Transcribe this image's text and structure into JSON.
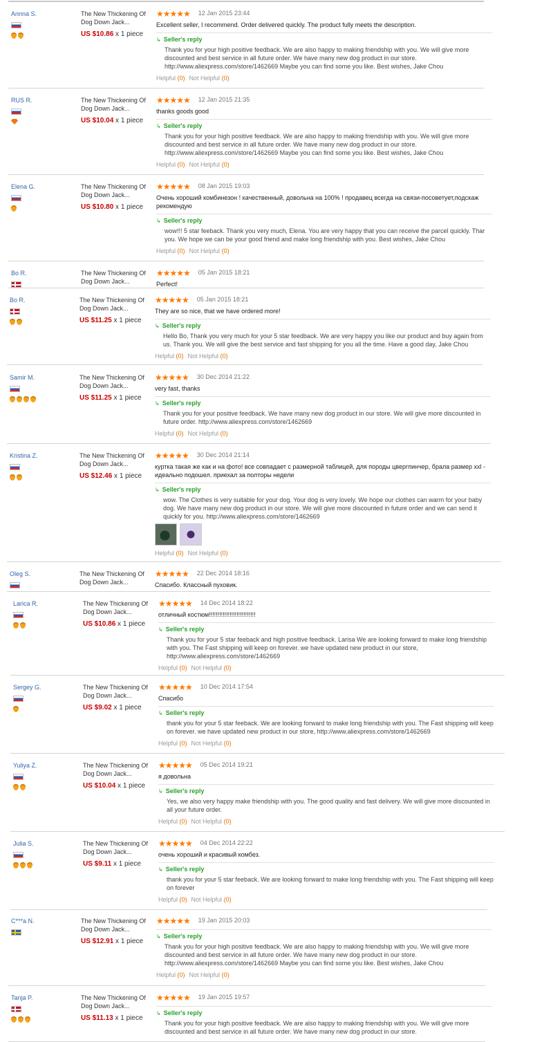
{
  "page": {
    "helpful_label": "Helpful",
    "not_helpful_label": "Not Helpful",
    "reply_label": "Seller's reply"
  },
  "reviews": [
    {
      "buyer": "Annna S.",
      "flag": "ru",
      "medals": 2,
      "product": "The New Thickening Of Dog Down Jack...",
      "price": "US $10.86",
      "qty": "x 1 piece",
      "stars": "★★★★★",
      "date": "12 Jan 2015 23:44",
      "feedback": "Excellent seller, I recommend. Order delivered quickly. The product fully meets the description.",
      "reply": "Thank you for your high positive feedback. We are also happy to making friendship with you. We will give more discounted and best service in all future order. We have many new dog product in our store. http://www.aliexpress.com/store/1462669 Maybe you can find some you like. Best wishes, Jake Chou",
      "helpful": "(0)",
      "not_helpful": "(0)"
    },
    {
      "buyer": "RUS R.",
      "flag": "ru",
      "medals": 0,
      "product": "The New Thickening Of Dog Down Jack...",
      "price": "US $10.04",
      "qty": "x 1 piece",
      "stars": "★★★★★",
      "date": "12 Jan 2015 21:35",
      "feedback": "thanks goods good",
      "reply": "Thank you for your high positive feedback. We are also happy to making friendship with you. We will give more discounted and best service in all future order. We have many new dog product in our store. http://www.aliexpress.com/store/1462669 Maybe you can find some you like. Best wishes, Jake Chou",
      "helpful": "(0)",
      "not_helpful": "(0)"
    },
    {
      "buyer": "Elena G.",
      "flag": "ru",
      "medals": 1,
      "product": "The New Thickening Of Dog Down Jack...",
      "price": "US $10.80",
      "qty": "x 1 piece",
      "stars": "★★★★★",
      "date": "08 Jan 2015 19:03",
      "feedback": "Очень хороший комбинезон ! качественный, довольна на 100% ! продавец всегда на связи-посоветует,подскаж рекомендую",
      "reply": "wow!!! 5 star feeback. Thank you very much, Elena. You are very happy that you can receive the parcel quickly. Thar you. We hope we can be your good friend and make long friendship with you. Best wishes, Jake Chou",
      "helpful": "(0)",
      "not_helpful": "(0)"
    },
    {
      "buyer": "Bo R.",
      "flag": "dk",
      "medals": 0,
      "product": "The New Thickening Of Dog Down Jack...",
      "price": "",
      "qty": "",
      "stars": "★★★★★",
      "date": "05 Jan 2015 18:21",
      "feedback": "Perfect!",
      "reply": "",
      "helpful": "",
      "not_helpful": ""
    },
    {
      "buyer": "Bo R.",
      "flag": "dk",
      "medals": 2,
      "product": "The New Thickening Of Dog Down Jack...",
      "price": "US $11.25",
      "qty": "x 1 piece",
      "stars": "★★★★★",
      "date": "05 Jan 2015 18:21",
      "feedback": "They are so nice, that we have ordered more!",
      "reply": "Hello Bo, Thank you very much for your 5 star feedback. We are very happy you like our product and buy again from us. Thank you. We will give the best service and fast shipping for you all the time. Have a good day, Jake Chou",
      "helpful": "(0)",
      "not_helpful": "(0)"
    },
    {
      "buyer": "Samir M.",
      "flag": "ru",
      "medals": 4,
      "product": "The New Thickening Of Dog Down Jack...",
      "price": "US $11.25",
      "qty": "x 1 piece",
      "stars": "★★★★★",
      "date": "30 Dec 2014 21:22",
      "feedback": "very fast, thanks",
      "reply": "Thank you for your positive feedback. We have many new dog product in our store. We will give more discounted in future order. http://www.aliexpress.com/store/1462669",
      "helpful": "(0)",
      "not_helpful": "(0)"
    },
    {
      "buyer": "Kristina Z.",
      "flag": "ru",
      "medals": 2,
      "product": "The New Thickening Of Dog Down Jack...",
      "price": "US $12.46",
      "qty": "x 1 piece",
      "stars": "★★★★★",
      "date": "30 Dec 2014 21:14",
      "feedback": "куртка такая же как и на фото! все совпадает с размерной таблицей, для породы цвергпинчер, брала размер xxl - идеально подошел. приехал за полторы недели",
      "reply": "wow. The Clothes is very suitable for your dog. Your dog is very lovely. We hope our clothes can warm for your baby dog. We have many new dog product in our store. We will give more discounted in future order and we can send it quickly for you. http://www.aliexpress.com/store/1462669",
      "helpful": "(0)",
      "not_helpful": "(0)"
    },
    {
      "buyer": "Oleg S.",
      "flag": "ru",
      "medals": 0,
      "product": "The New Thickening Of Dog Down Jack...",
      "price": "",
      "qty": "",
      "stars": "★★★★★",
      "date": "22 Dec 2014 18:16",
      "feedback": "Спасибо. Классный пуховик.",
      "reply": "",
      "helpful": "",
      "not_helpful": ""
    },
    {
      "buyer": "Larica R.",
      "flag": "ru",
      "medals": 2,
      "product": "The New Thickening Of Dog Down Jack...",
      "price": "US $10.86",
      "qty": "x 1 piece",
      "stars": "★★★★★",
      "date": "14 Dec 2014 18:22",
      "feedback": "отличный костюм!!!!!!!!!!!!!!!!!!!!!!!!!!!",
      "reply": "Thank you for your 5 star feeback and high positive feedback. Larisa We are looking forward to make long friendship with you. The Fast shipping will keep on forever. we have updated new product in our store, http://www.aliexpress.com/store/1462669",
      "helpful": "(0)",
      "not_helpful": "(0)"
    },
    {
      "buyer": "Sergey G.",
      "flag": "ru",
      "medals": 1,
      "product": "The New Thickening Of Dog Down Jack...",
      "price": "US $9.02",
      "qty": "x 1 piece",
      "stars": "★★★★★",
      "date": "10 Dec 2014 17:54",
      "feedback": "Спасибо",
      "reply": "thank you for your 5 star feeback. We are looking forward to make long friendship with you. The Fast shipping will keep on forever. we have updated new product in our store, http://www.aliexpress.com/store/1462669",
      "helpful": "(0)",
      "not_helpful": "(0)"
    },
    {
      "buyer": "Yuliya Z.",
      "flag": "ru",
      "medals": 2,
      "product": "The New Thickening Of Dog Down Jack...",
      "price": "US $10.04",
      "qty": "x 1 piece",
      "stars": "★★★★★",
      "date": "05 Dec 2014 19:21",
      "feedback": "я довольна",
      "reply": "Yes, we also very happy make friendship with you. The good quality and fast delivery. We will give more discounted in all your future order.",
      "helpful": "(0)",
      "not_helpful": "(0)"
    },
    {
      "buyer": "Julia S.",
      "flag": "ru",
      "medals": 3,
      "product": "The New Thickening Of Dog Down Jack...",
      "price": "US $9.11",
      "qty": "x 1 piece",
      "stars": "★★★★★",
      "date": "04 Dec 2014 22:22",
      "feedback": "очень хороший и красивый комбез.",
      "reply": "thank you for your 5 star feeback. We are looking forward to make long friendship with you. The Fast shipping will keep on forever",
      "helpful": "(0)",
      "not_helpful": "(0)"
    },
    {
      "buyer": "C***a N.",
      "flag": "se",
      "medals": 0,
      "product": "The New Thickening Of Dog Down Jack...",
      "price": "US $12.91",
      "qty": "x 1 piece",
      "stars": "★★★★★",
      "date": "19 Jan 2015 20:03",
      "feedback": "",
      "reply": "Thank you for your high positive feedback. We are also happy to making friendship with you. We will give more discounted and best service in all future order. We have many new dog product in our store. http://www.aliexpress.com/store/1462669 Maybe you can find some you like. Best wishes, Jake Chou",
      "helpful": "(0)",
      "not_helpful": "(0)"
    },
    {
      "buyer": "Tanja P.",
      "flag": "dk",
      "medals": 3,
      "product": "The New Thickening Of Dog Down Jack...",
      "price": "US $11.13",
      "qty": "x 1 piece",
      "stars": "★★★★★",
      "date": "19 Jan 2015 19:57",
      "feedback": "",
      "reply": "Thank you for your high positive feedback. We are also happy to making friendship with you. We will give more discounted and best service in all future order. We have many new dog product in our store.",
      "helpful": "",
      "not_helpful": ""
    }
  ]
}
